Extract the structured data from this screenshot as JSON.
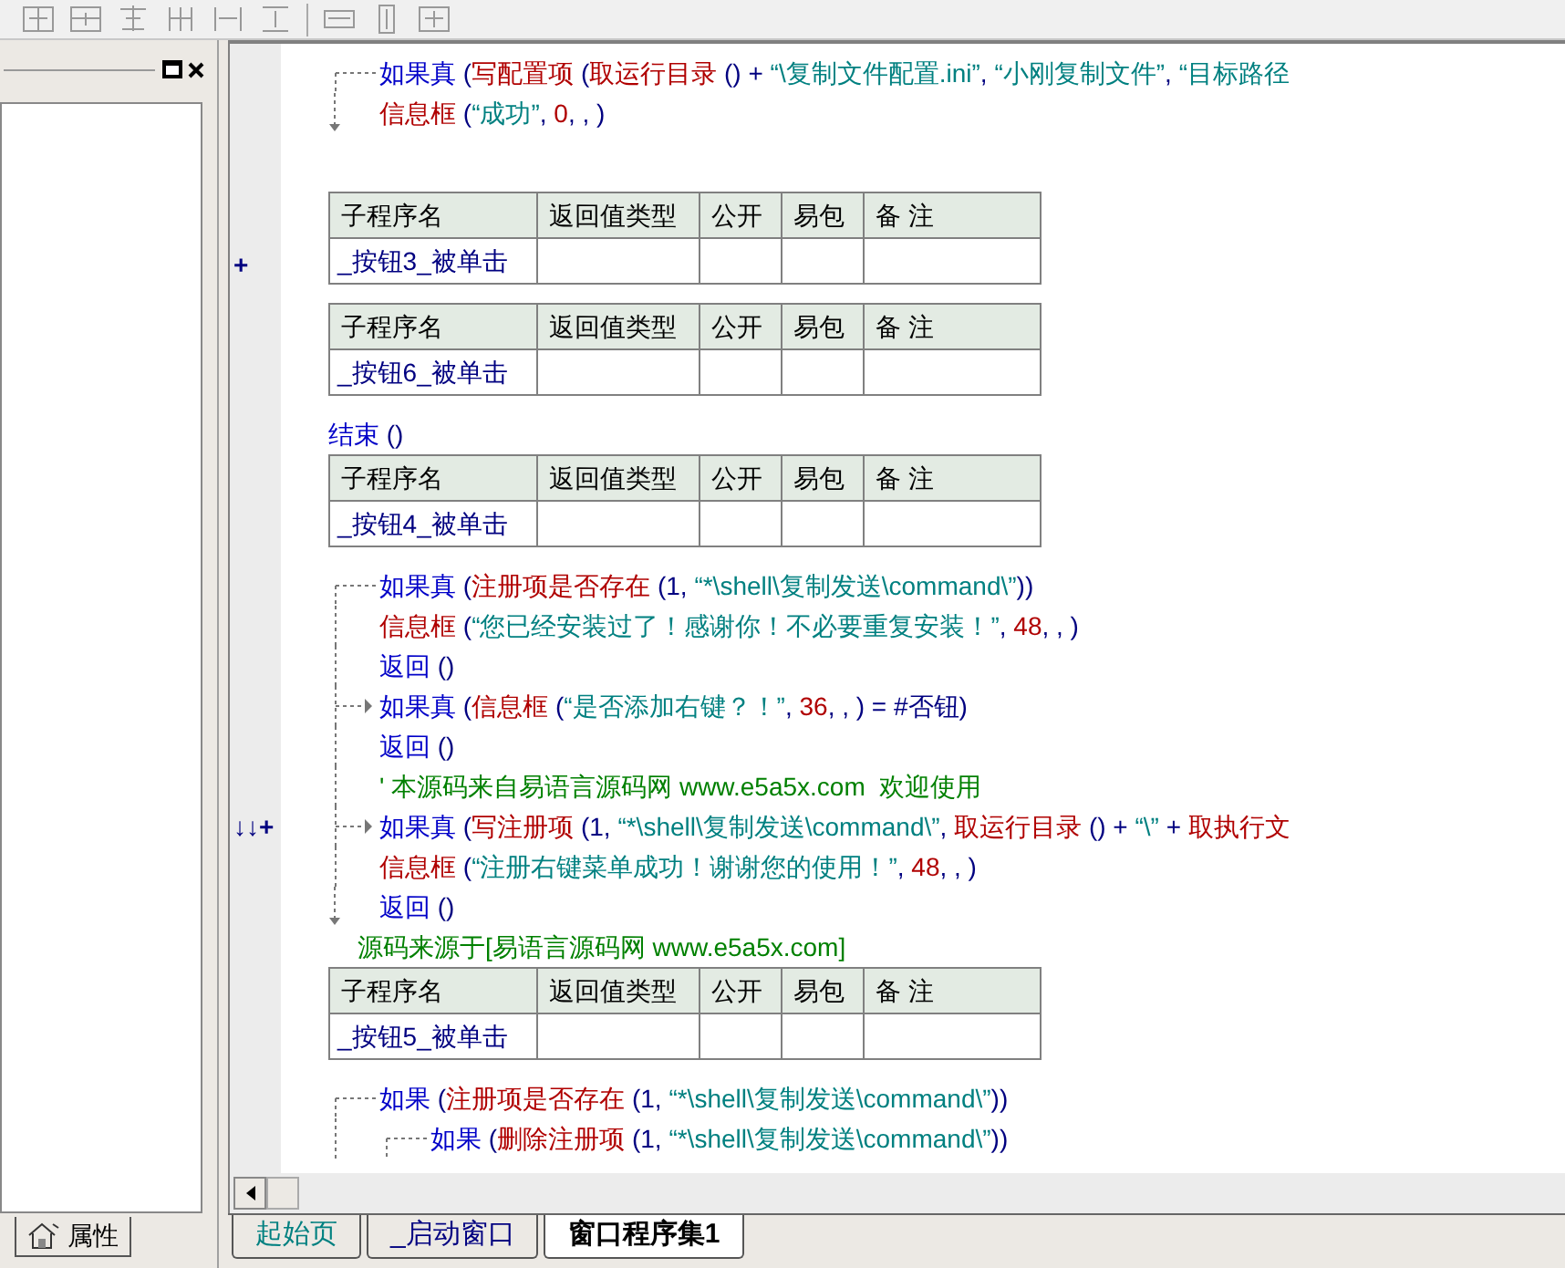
{
  "left_panel": {
    "tab": "属性"
  },
  "editor": {
    "lines": [
      {
        "kind": "block_start",
        "segments": [
          {
            "kind": "kw",
            "text": "如果真"
          },
          {
            "kind": "op",
            "text": " ("
          },
          {
            "kind": "fn",
            "text": "写配置项"
          },
          {
            "kind": "op",
            "text": " ("
          },
          {
            "kind": "fn",
            "text": "取运行目录"
          },
          {
            "kind": "op",
            "text": " () + "
          },
          {
            "kind": "str",
            "text": "“\\复制文件配置.ini”"
          },
          {
            "kind": "op",
            "text": ", "
          },
          {
            "kind": "str",
            "text": "“小刚复制文件”"
          },
          {
            "kind": "op",
            "text": ", "
          },
          {
            "kind": "str",
            "text": "“目标路径"
          }
        ]
      },
      {
        "kind": "block_end",
        "segments": [
          {
            "kind": "fn",
            "text": "信息框"
          },
          {
            "kind": "op",
            "text": " ("
          },
          {
            "kind": "str",
            "text": "“成功”"
          },
          {
            "kind": "op",
            "text": ", "
          },
          {
            "kind": "num",
            "text": "0"
          },
          {
            "kind": "op",
            "text": ", , )"
          }
        ]
      },
      {
        "kind": "table",
        "gutter": "+",
        "columns": [
          "子程序名",
          "返回值类型",
          "公开",
          "易包",
          "备 注"
        ],
        "name": "_按钮3_被单击"
      },
      {
        "kind": "table",
        "columns": [
          "子程序名",
          "返回值类型",
          "公开",
          "易包",
          "备 注"
        ],
        "name": "_按钮6_被单击"
      },
      {
        "kind": "top",
        "segments": [
          {
            "kind": "kw",
            "text": "结束"
          },
          {
            "kind": "op",
            "text": " ()"
          }
        ]
      },
      {
        "kind": "table",
        "columns": [
          "子程序名",
          "返回值类型",
          "公开",
          "易包",
          "备 注"
        ],
        "name": "_按钮4_被单击"
      },
      {
        "kind": "block_start",
        "segments": [
          {
            "kind": "kw",
            "text": "如果真"
          },
          {
            "kind": "op",
            "text": " ("
          },
          {
            "kind": "fn",
            "text": "注册项是否存在"
          },
          {
            "kind": "op",
            "text": " (1, "
          },
          {
            "kind": "str",
            "text": "“*\\shell\\复制发送\\command\\”"
          },
          {
            "kind": "op",
            "text": "))"
          }
        ]
      },
      {
        "kind": "block_line",
        "segments": [
          {
            "kind": "fn",
            "text": "信息框"
          },
          {
            "kind": "op",
            "text": " ("
          },
          {
            "kind": "str",
            "text": "“您已经安装过了！感谢你！不必要重复安装！”"
          },
          {
            "kind": "op",
            "text": ", "
          },
          {
            "kind": "num",
            "text": "48"
          },
          {
            "kind": "op",
            "text": ", , )"
          }
        ]
      },
      {
        "kind": "block_line",
        "segments": [
          {
            "kind": "kw",
            "text": "返回"
          },
          {
            "kind": "op",
            "text": " ()"
          }
        ]
      },
      {
        "kind": "block_branch",
        "segments": [
          {
            "kind": "kw",
            "text": "如果真"
          },
          {
            "kind": "op",
            "text": " ("
          },
          {
            "kind": "fn",
            "text": "信息框"
          },
          {
            "kind": "op",
            "text": " ("
          },
          {
            "kind": "str",
            "text": "“是否添加右键？！”"
          },
          {
            "kind": "op",
            "text": ", "
          },
          {
            "kind": "num",
            "text": "36"
          },
          {
            "kind": "op",
            "text": ", , ) = #否钮)"
          }
        ]
      },
      {
        "kind": "block_line",
        "segments": [
          {
            "kind": "kw",
            "text": "返回"
          },
          {
            "kind": "op",
            "text": " ()"
          }
        ]
      },
      {
        "kind": "block_line",
        "segments": [
          {
            "kind": "cmt",
            "text": "' 本源码来自易语言源码网 www.e5a5x.com  欢迎使用"
          }
        ]
      },
      {
        "kind": "block_branch",
        "gutter": "↓↓+",
        "segments": [
          {
            "kind": "kw",
            "text": "如果真"
          },
          {
            "kind": "op",
            "text": " ("
          },
          {
            "kind": "fn",
            "text": "写注册项"
          },
          {
            "kind": "op",
            "text": " (1, "
          },
          {
            "kind": "str",
            "text": "“*\\shell\\复制发送\\command\\”"
          },
          {
            "kind": "op",
            "text": ", "
          },
          {
            "kind": "fn",
            "text": "取运行目录"
          },
          {
            "kind": "op",
            "text": " () + "
          },
          {
            "kind": "str",
            "text": "“\\”"
          },
          {
            "kind": "op",
            "text": " + "
          },
          {
            "kind": "fn",
            "text": "取执行文"
          }
        ]
      },
      {
        "kind": "block_line",
        "segments": [
          {
            "kind": "fn",
            "text": "信息框"
          },
          {
            "kind": "op",
            "text": " ("
          },
          {
            "kind": "str",
            "text": "“注册右键菜单成功！谢谢您的使用！”"
          },
          {
            "kind": "op",
            "text": ", "
          },
          {
            "kind": "num",
            "text": "48"
          },
          {
            "kind": "op",
            "text": ", , )"
          }
        ]
      },
      {
        "kind": "block_end",
        "segments": [
          {
            "kind": "kw",
            "text": "返回"
          },
          {
            "kind": "op",
            "text": " ()"
          }
        ]
      },
      {
        "kind": "trailer",
        "segments": [
          {
            "kind": "cmt",
            "text": "源码来源于[易语言源码网 www.e5a5x.com]"
          }
        ]
      },
      {
        "kind": "table",
        "columns": [
          "子程序名",
          "返回值类型",
          "公开",
          "易包",
          "备 注"
        ],
        "name": "_按钮5_被单击"
      },
      {
        "kind": "block_start",
        "segments": [
          {
            "kind": "kw",
            "text": "如果"
          },
          {
            "kind": "op",
            "text": " ("
          },
          {
            "kind": "fn",
            "text": "注册项是否存在"
          },
          {
            "kind": "op",
            "text": " (1, "
          },
          {
            "kind": "str",
            "text": "“*\\shell\\复制发送\\command\\”"
          },
          {
            "kind": "op",
            "text": "))"
          }
        ],
        "children": [
          {
            "kind": "block_start",
            "segments": [
              {
                "kind": "kw",
                "text": "如果"
              },
              {
                "kind": "op",
                "text": " ("
              },
              {
                "kind": "fn",
                "text": "删除注册项"
              },
              {
                "kind": "op",
                "text": " (1, "
              },
              {
                "kind": "str",
                "text": "“*\\shell\\复制发送\\command\\”"
              },
              {
                "kind": "op",
                "text": "))"
              }
            ]
          }
        ]
      }
    ]
  },
  "tabs": [
    {
      "label": "起始页",
      "selected": false
    },
    {
      "label": "_启动窗口",
      "selected": false
    },
    {
      "label": "窗口程序集1",
      "selected": true
    }
  ]
}
